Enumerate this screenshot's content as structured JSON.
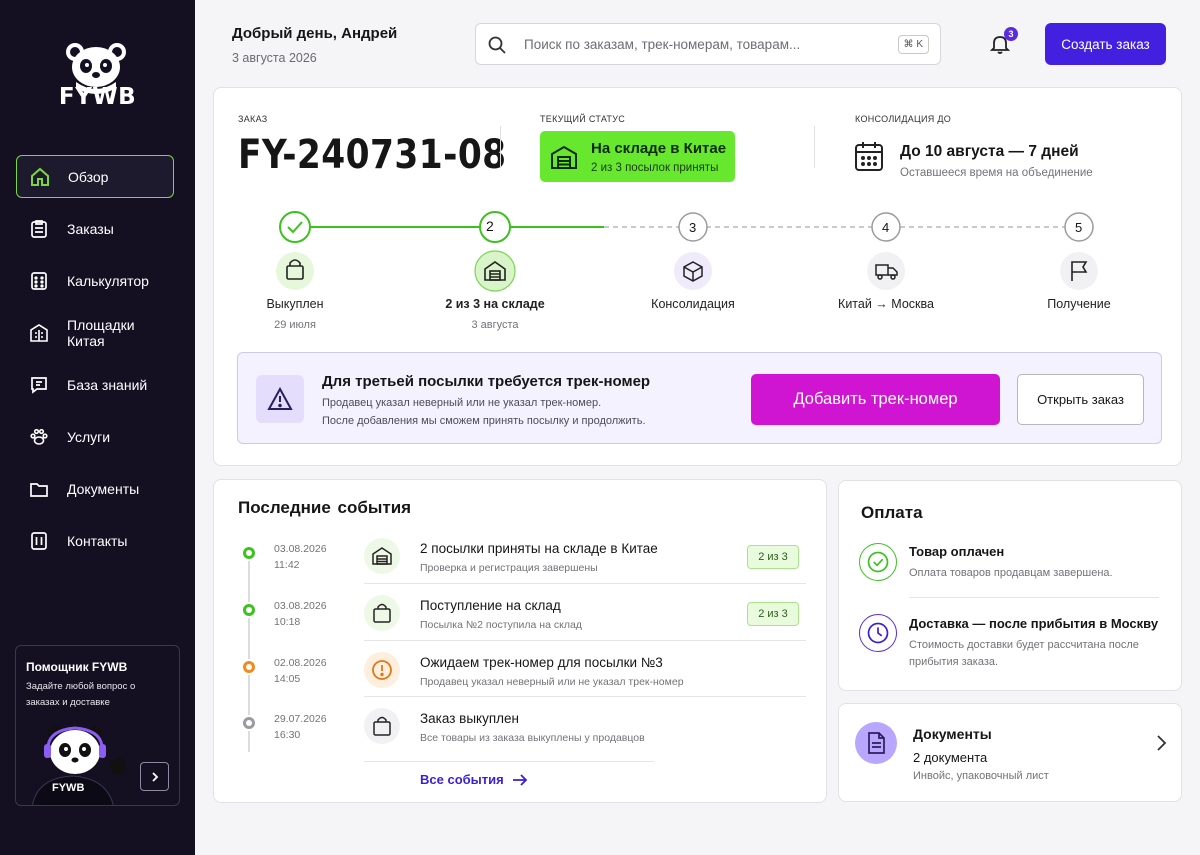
{
  "brand": {
    "name": "FYWB",
    "accent": "#4320e0",
    "active_border": "#7dd63a"
  },
  "sidebar": {
    "items": [
      {
        "label": "Обзор",
        "icon": "home-icon",
        "active": true
      },
      {
        "label": "Заказы",
        "icon": "clipboard-icon",
        "active": false
      },
      {
        "label": "Калькулятор",
        "icon": "calculator-icon",
        "active": false
      },
      {
        "label": "Площадки Китая",
        "icon": "building-icon",
        "active": false
      },
      {
        "label": "База знаний",
        "icon": "message-icon",
        "active": false
      },
      {
        "label": "Услуги",
        "icon": "paw-icon",
        "active": false
      },
      {
        "label": "Документы",
        "icon": "folder-icon",
        "active": false
      },
      {
        "label": "Контакты",
        "icon": "contacts-icon",
        "active": false
      }
    ],
    "helper": {
      "title": "Помощник FYWB",
      "subtitle": "Задайте любой вопрос о заказах и доставке",
      "mascot_label": "FYWB"
    }
  },
  "header": {
    "greeting": "Добрый день, Андрей",
    "date": "3 августа 2026",
    "search_placeholder": "Поиск по заказам, трек-номерам, товарам...",
    "search_shortcut": "⌘ K",
    "notifications_count": "3",
    "create_button": "Создать заказ"
  },
  "order": {
    "label": "ЗАКАЗ",
    "number": "FY-240731-08",
    "status_label": "ТЕКУЩИЙ СТАТУС",
    "status_title": "На складе в Китае",
    "status_sub": "2 из 3 посылок приняты",
    "status_color": "#67e82e",
    "cons_label": "КОНСОЛИДАЦИЯ ДО",
    "cons_title": "До 10 августа — 7 дней",
    "cons_sub": "Оставшееся время на объединение",
    "steps": [
      {
        "num": "",
        "label": "Выкуплен",
        "sub": "29 июля",
        "state": "done",
        "icon": "bag-icon"
      },
      {
        "num": "2",
        "label": "2 из 3 на складе",
        "sub": "3 августа",
        "state": "current",
        "icon": "warehouse-icon"
      },
      {
        "num": "3",
        "label": "Консолидация",
        "sub": "",
        "state": "pending",
        "icon": "box-icon"
      },
      {
        "num": "4",
        "label": "Китай → Москва",
        "sub": "",
        "state": "pending",
        "icon": "truck-icon"
      },
      {
        "num": "5",
        "label": "Получение",
        "sub": "",
        "state": "pending",
        "icon": "flag-icon"
      }
    ],
    "alert": {
      "title": "Для третьей посылки требуется трек-номер",
      "line1": "Продавец указал неверный или не указал трек-номер.",
      "line2": "После добавления мы сможем принять посылку и продолжить.",
      "primary": "Добавить трек-номер",
      "secondary": "Открыть заказ"
    }
  },
  "events": {
    "title": "Последние  события",
    "items": [
      {
        "date": "03.08.2026",
        "time": "11:42",
        "title": "2 посылки приняты на складе в Китае",
        "sub": "Проверка и регистрация завершены",
        "badge": "2 из 3",
        "dot": "#3cc21e",
        "icon": "warehouse-icon",
        "icon_bg": "#eef8e6"
      },
      {
        "date": "03.08.2026",
        "time": "10:18",
        "title": "Поступление на склад",
        "sub": "Посылка №2 поступила на склад",
        "badge": "2 из 3",
        "dot": "#3cc21e",
        "icon": "bag-icon",
        "icon_bg": "#eef8e6"
      },
      {
        "date": "02.08.2026",
        "time": "14:05",
        "title": "Ожидаем трек-номер для посылки №3",
        "sub": "Продавец указал неверный или не указал трек-номер",
        "badge": "",
        "dot": "#f28a1c",
        "icon": "alert-circle-icon",
        "icon_bg": "#fdeedd"
      },
      {
        "date": "29.07.2026",
        "time": "16:30",
        "title": "Заказ выкуплен",
        "sub": "Все товары из заказа выкуплены у продавцов",
        "badge": "",
        "dot": "#9a9aa2",
        "icon": "bag-icon",
        "icon_bg": "#f1f1f4"
      }
    ],
    "all_link": "Все события"
  },
  "payment": {
    "title": "Оплата",
    "items": [
      {
        "title": "Товар оплачен",
        "sub": "Оплата товаров продавцам завершена.",
        "icon": "check-circle-icon"
      },
      {
        "title": "Доставка — после прибытия в Москву",
        "sub": "Стоимость доставки будет рассчитана после прибытия заказа.",
        "icon": "clock-icon"
      }
    ]
  },
  "documents": {
    "title": "Документы",
    "count": "2 документа",
    "sub": "Инвойс, упаковочный лист"
  }
}
